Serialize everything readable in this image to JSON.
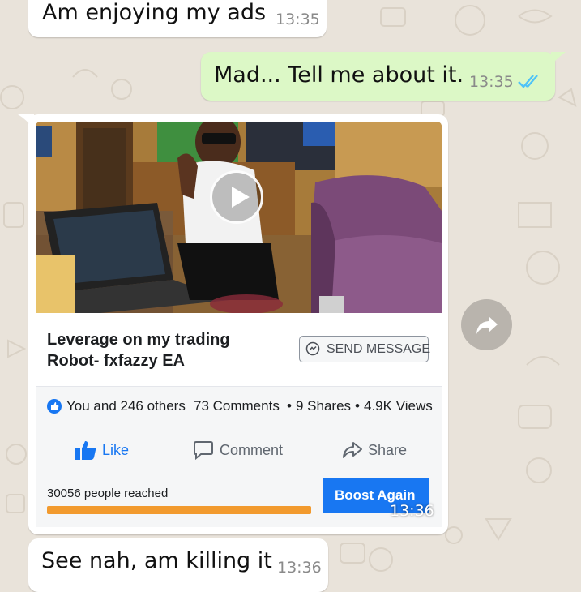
{
  "messages": [
    {
      "text": "Am enjoying my ads",
      "time": "13:35",
      "direction": "incoming"
    },
    {
      "text": "Mad... Tell me about it.",
      "time": "13:35",
      "direction": "outgoing",
      "status": "read",
      "status_icon": "double-check-icon"
    },
    {
      "text": "See nah, am killing it",
      "time": "13:36",
      "direction": "incoming"
    }
  ],
  "media_message": {
    "time": "13:36",
    "post": {
      "title_line1": "Leverage on my trading",
      "title_line2": "Robot- fxfazzy EA",
      "send_message_label": "SEND MESSAGE",
      "reactions": "You and 246 others",
      "comments": "73 Comments",
      "shares": "9 Shares",
      "views": "4.9K Views",
      "separator": "•",
      "actions": {
        "like": "Like",
        "comment": "Comment",
        "share": "Share"
      },
      "reach_text": "30056 people reached",
      "reach_progress_percent": 100,
      "boost_label": "Boost Again"
    }
  },
  "forward_icon": "forward-arrow-icon",
  "colors": {
    "chat_background": "#e9e3da",
    "outgoing_bubble": "#dcf8c6",
    "incoming_bubble": "#ffffff",
    "read_ticks": "#4fc3f7",
    "facebook_blue": "#1877f2",
    "reach_bar": "#f29a2e"
  }
}
